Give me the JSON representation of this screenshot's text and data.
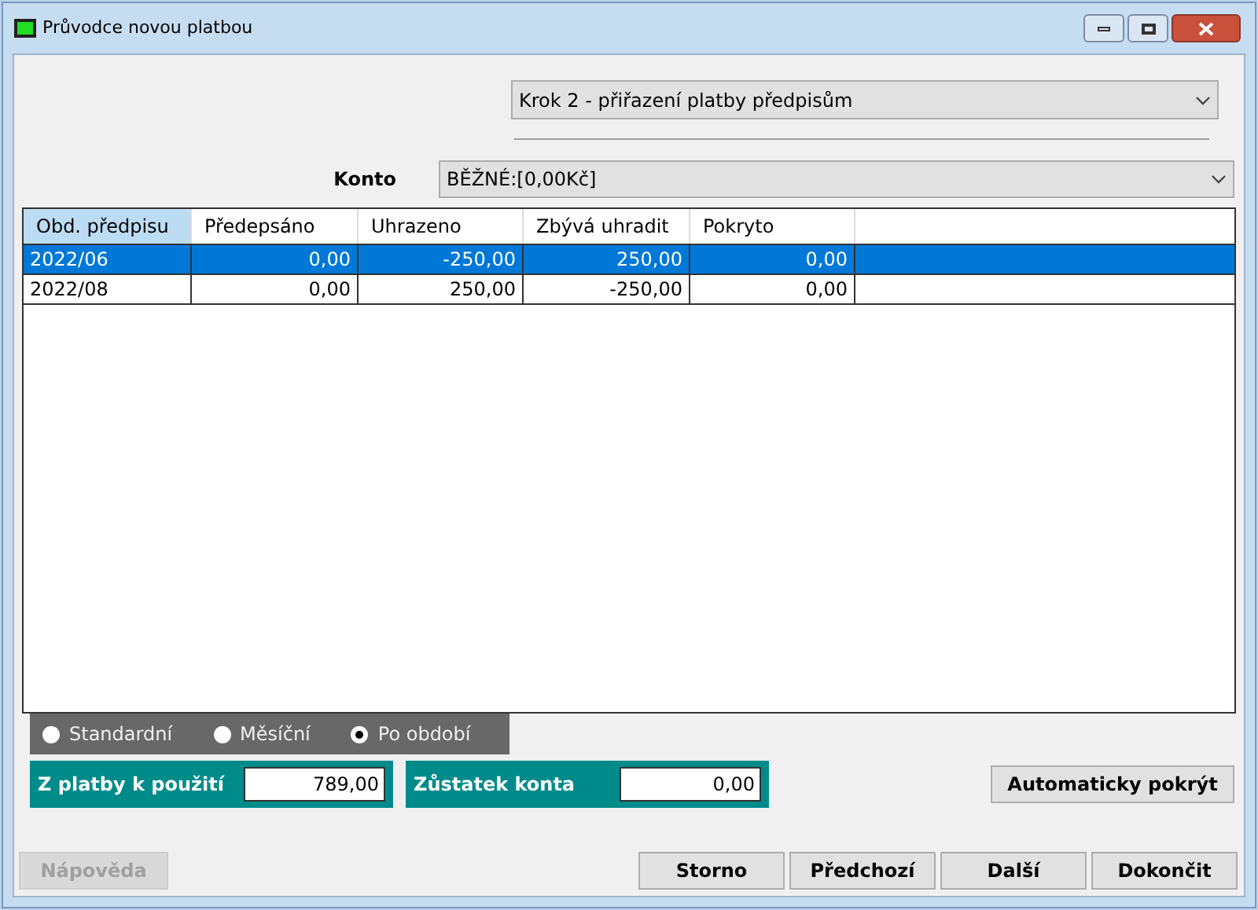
{
  "window": {
    "title": "Průvodce novou platbou"
  },
  "step_select": {
    "value": "Krok 2 - přiřazení platby předpisům"
  },
  "account": {
    "label": "Konto",
    "value": "BĚŽNÉ:[0,00Kč]"
  },
  "table": {
    "columns": [
      {
        "label": "Obd. předpisu",
        "selected": true
      },
      {
        "label": "Předepsáno",
        "selected": false
      },
      {
        "label": "Uhrazeno",
        "selected": false
      },
      {
        "label": "Zbývá uhradit",
        "selected": false
      },
      {
        "label": "Pokryto",
        "selected": false
      }
    ],
    "rows": [
      {
        "selected": true,
        "cells": [
          "2022/06",
          "0,00",
          "-250,00",
          "250,00",
          "0,00"
        ]
      },
      {
        "selected": false,
        "cells": [
          "2022/08",
          "0,00",
          "250,00",
          "-250,00",
          "0,00"
        ]
      }
    ]
  },
  "modes": [
    {
      "label": "Standardní",
      "selected": false
    },
    {
      "label": "Měsíční",
      "selected": false
    },
    {
      "label": "Po období",
      "selected": true
    }
  ],
  "totals": [
    {
      "label": "Z platby k použití",
      "value": "789,00"
    },
    {
      "label": "Zůstatek konta",
      "value": "0,00"
    }
  ],
  "auto_button": "Automaticky pokrýt",
  "help_button": {
    "label": "Nápověda",
    "disabled": true
  },
  "buttons": [
    {
      "label": "Storno",
      "disabled": false
    },
    {
      "label": "Předchozí",
      "disabled": false
    },
    {
      "label": "Další",
      "disabled": false
    },
    {
      "label": "Dokončit",
      "disabled": false
    }
  ]
}
